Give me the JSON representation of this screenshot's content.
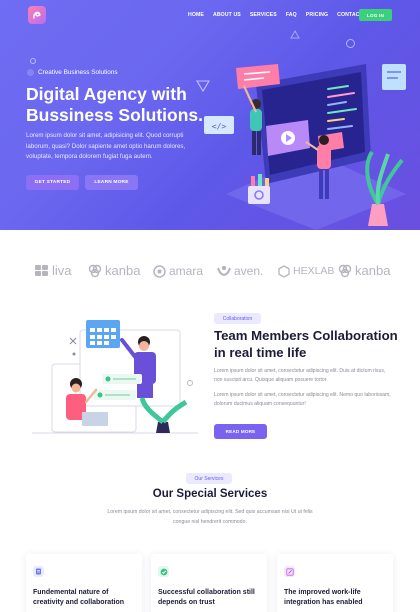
{
  "nav": {
    "items": [
      "HOME",
      "ABOUT US",
      "SERVICES",
      "FAQ",
      "PRICING",
      "CONTACT"
    ],
    "login_label": "LOG IN"
  },
  "hero": {
    "eyebrow": "Creative Business Solutions",
    "title": "Digital Agency with Bussiness Solutions.",
    "text": "Lorem ipsum dolor sit amet, adipisicing elit. Quod corrupti laborum, quasi? Dolor sapiente amet optio harum dolores, voluptate, tempora dolorem fugiat fuga autem.",
    "btn_start": "GET STARTED",
    "btn_learn": "LEARN MORE"
  },
  "brands": [
    "liva",
    "kanba",
    "amara",
    "aven.",
    "HEXLAB",
    "kanba"
  ],
  "collab": {
    "pill": "Collaboration",
    "title": "Team Members Collaboration in real time life",
    "p1": "Lorem ipsum dolor sit amet, consectetur adipiscing elit. Duis at dictum risus, non suscipit arcu. Quisque aliquam posuere tortor",
    "p2": "Lorem ipsum dolor sit amet, consectetur adipiscing elit. Nemo quo laboriosam, dolorum ducimus aliquam consequuntur!",
    "read_more": "READ MORE"
  },
  "services": {
    "pill": "Our Services",
    "title": "Our Special Services",
    "text": "Lorem ipsum dolor sit amet, consectetur adipiscing elit. Sed quis accumsan nisi Ut ut felis congue nisl hendrerit commodo.",
    "cards": [
      {
        "title": "Fundemental nature of creativity and collaboration",
        "icon": "document-icon",
        "color": "#6a78f2",
        "bg": "#e9ecfd"
      },
      {
        "title": "Successful collaboration still depends on trust",
        "icon": "check-circle-icon",
        "color": "#34c58a",
        "bg": "#e3f7ee"
      },
      {
        "title": "The improved work-life integration has enabled",
        "icon": "edit-icon",
        "color": "#c062e6",
        "bg": "#f5e6fb"
      }
    ]
  },
  "colors": {
    "hero_gradient": [
      "#6f6df2",
      "#6a4fe0"
    ],
    "accent": "#7a63f0",
    "login_green": "#3bd17a",
    "heading": "#1c1c3a"
  }
}
